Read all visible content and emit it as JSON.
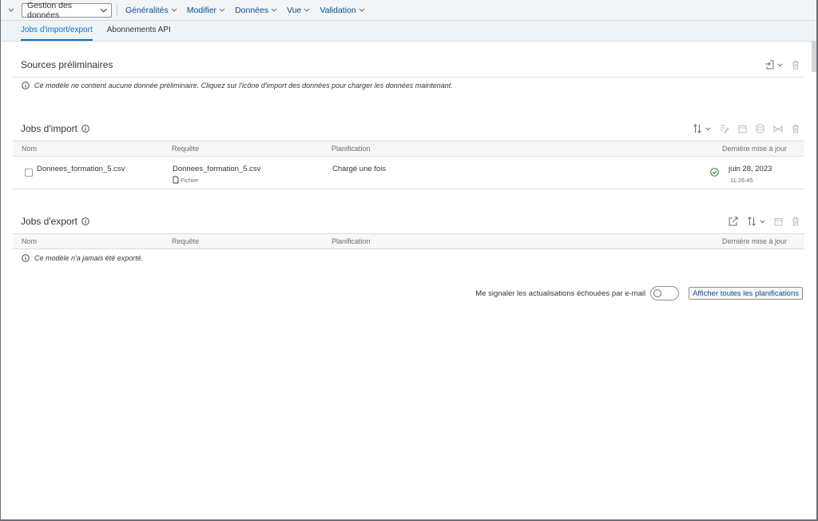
{
  "toolbar": {
    "mode_select": "Gestion des données",
    "menus": [
      {
        "label": "Généralités"
      },
      {
        "label": "Modifier"
      },
      {
        "label": "Données"
      },
      {
        "label": "Vue"
      },
      {
        "label": "Validation"
      }
    ]
  },
  "tabs": [
    {
      "label": "Jobs d'import/export",
      "active": true
    },
    {
      "label": "Abonnements API",
      "active": false
    }
  ],
  "sources": {
    "title": "Sources préliminaires",
    "info": "Ce modèle ne contient aucune donnée préliminaire. Cliquez sur l'icône d'import des données pour charger les données maintenant."
  },
  "imports": {
    "title": "Jobs d'import",
    "columns": {
      "name": "Nom",
      "query": "Requête",
      "schedule": "Planification",
      "updated": "Dernière mise à jour"
    },
    "rows": [
      {
        "name": "Donnees_formation_5.csv",
        "query": "Donnees_formation_5.csv",
        "query_type": "Fichier",
        "schedule": "Chargé une fois",
        "date": "juin 28, 2023",
        "time": "11:26:45",
        "status_color": "#2b7c2b"
      }
    ]
  },
  "exports": {
    "title": "Jobs d'export",
    "columns": {
      "name": "Nom",
      "query": "Requête",
      "schedule": "Planification",
      "updated": "Dernière mise à jour"
    },
    "info": "Ce modèle n'a jamais été exporté."
  },
  "footer": {
    "notify_label": "Me signaler les actualisations échouées par e-mail",
    "notify_on": false,
    "show_schedules": "Afficher toutes les planifications"
  },
  "colors": {
    "accent": "#0a6ed1",
    "link": "#0a4e8c"
  }
}
